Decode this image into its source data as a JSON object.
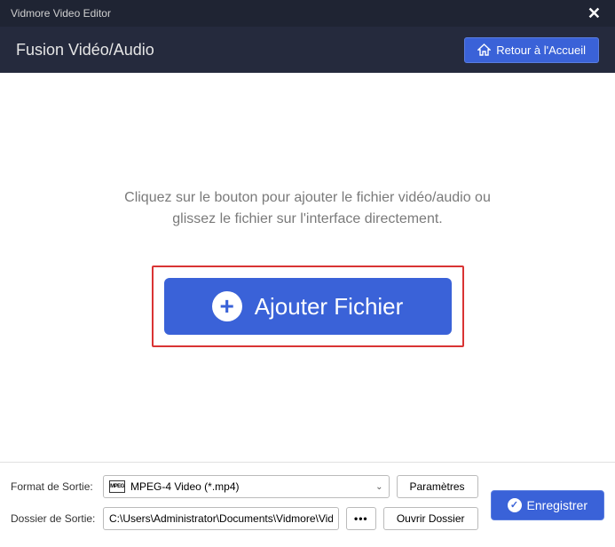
{
  "titlebar": {
    "app_name": "Vidmore Video Editor"
  },
  "header": {
    "title": "Fusion Vidéo/Audio",
    "home_label": "Retour à l'Accueil"
  },
  "main": {
    "instruction": "Cliquez sur le bouton pour ajouter le fichier vidéo/audio ou glissez le fichier sur l'interface directement.",
    "add_file_label": "Ajouter Fichier"
  },
  "bottom": {
    "format_label": "Format de Sortie:",
    "format_value": "MPEG-4 Video (*.mp4)",
    "format_icon_text": "MPEG",
    "settings_label": "Paramètres",
    "folder_label": "Dossier de Sortie:",
    "folder_value": "C:\\Users\\Administrator\\Documents\\Vidmore\\Video",
    "browse_label": "•••",
    "open_folder_label": "Ouvrir Dossier",
    "save_label": "Enregistrer"
  },
  "colors": {
    "accent": "#3a62d8",
    "highlight_border": "#d93434",
    "titlebar_bg": "#1f2433",
    "header_bg": "#252a3d"
  }
}
